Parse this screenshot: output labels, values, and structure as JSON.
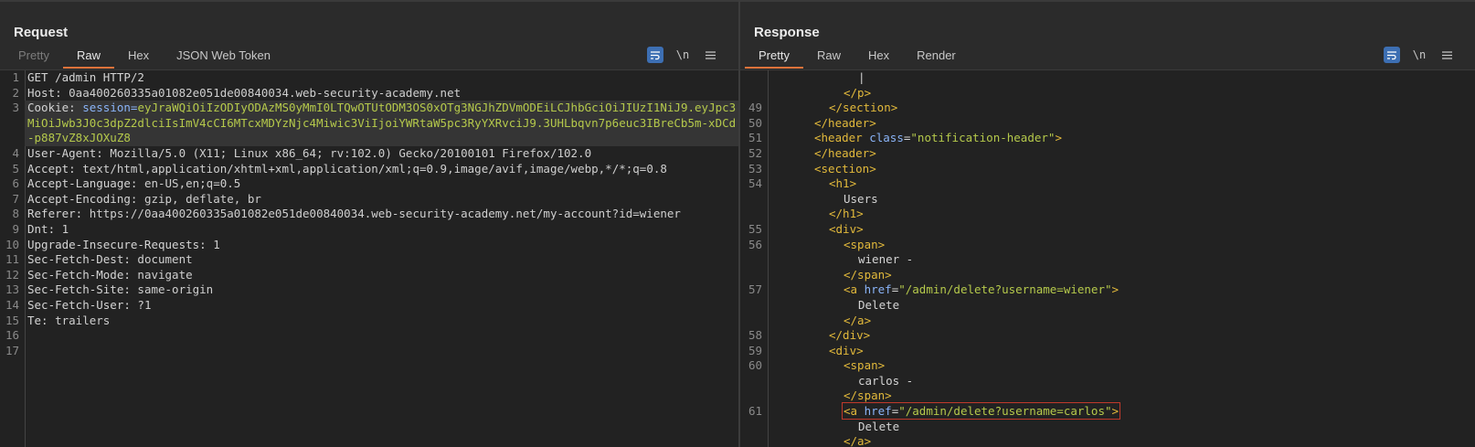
{
  "request": {
    "title": "Request",
    "tabs": [
      {
        "label": "Pretty",
        "state": "disabled"
      },
      {
        "label": "Raw",
        "state": "active"
      },
      {
        "label": "Hex",
        "state": "normal"
      },
      {
        "label": "JSON Web Token",
        "state": "normal"
      }
    ],
    "tools": {
      "wrap_icon": "wrap-lines-icon",
      "newline_label": "\\n",
      "menu_icon": "menu-icon"
    },
    "lines": [
      {
        "n": "1",
        "name": "GET /admin HTTP/2",
        "value": ""
      },
      {
        "n": "2",
        "name": "Host: ",
        "value": "0aa400260335a01082e051de00840034.web-security-academy.net"
      },
      {
        "n": "3",
        "name": "Cookie: ",
        "cookie_name": "session=",
        "cookie_value": "eyJraWQiOiIzODIyODAzMS0yMmI0LTQwOTUtODM3OS0xOTg3NGJhZDVmODEiLCJhbGciOiJIUzI1NiJ9.eyJpc3MiOiJwb3J0c3dpZ2dlciIsImV4cCI6MTcxMDYzNjc4Miwic3ViIjoiYWRtaW5pc3RyYXRvciJ9.3UHLbqvn7p6euc3IBreCb5m-xDCd-p887vZ8xJOXuZ8"
      },
      {
        "n": "4",
        "name": "User-Agent: ",
        "value": "Mozilla/5.0 (X11; Linux x86_64; rv:102.0) Gecko/20100101 Firefox/102.0"
      },
      {
        "n": "5",
        "name": "Accept: ",
        "value": "text/html,application/xhtml+xml,application/xml;q=0.9,image/avif,image/webp,*/*;q=0.8"
      },
      {
        "n": "6",
        "name": "Accept-Language: ",
        "value": "en-US,en;q=0.5"
      },
      {
        "n": "7",
        "name": "Accept-Encoding: ",
        "value": "gzip, deflate, br"
      },
      {
        "n": "8",
        "name": "Referer: ",
        "value": "https://0aa400260335a01082e051de00840034.web-security-academy.net/my-account?id=wiener"
      },
      {
        "n": "9",
        "name": "Dnt: ",
        "value": "1"
      },
      {
        "n": "10",
        "name": "Upgrade-Insecure-Requests: ",
        "value": "1"
      },
      {
        "n": "11",
        "name": "Sec-Fetch-Dest: ",
        "value": "document"
      },
      {
        "n": "12",
        "name": "Sec-Fetch-Mode: ",
        "value": "navigate"
      },
      {
        "n": "13",
        "name": "Sec-Fetch-Site: ",
        "value": "same-origin"
      },
      {
        "n": "14",
        "name": "Sec-Fetch-User: ",
        "value": "?1"
      },
      {
        "n": "15",
        "name": "Te: ",
        "value": "trailers"
      },
      {
        "n": "16",
        "name": "",
        "value": ""
      },
      {
        "n": "17",
        "name": "",
        "value": ""
      }
    ]
  },
  "response": {
    "title": "Response",
    "tabs": [
      {
        "label": "Pretty",
        "state": "active"
      },
      {
        "label": "Raw",
        "state": "normal"
      },
      {
        "label": "Hex",
        "state": "normal"
      },
      {
        "label": "Render",
        "state": "normal"
      }
    ],
    "tools": {
      "wrap_icon": "wrap-lines-icon",
      "newline_label": "\\n",
      "menu_icon": "menu-icon"
    },
    "lines": [
      {
        "n": "",
        "indent": 6,
        "parts": [
          {
            "c": "txt",
            "t": "|"
          }
        ]
      },
      {
        "n": "",
        "indent": 5,
        "parts": [
          {
            "c": "tag",
            "t": "</p>"
          }
        ]
      },
      {
        "n": "49",
        "indent": 4,
        "parts": [
          {
            "c": "tag",
            "t": "</section>"
          }
        ]
      },
      {
        "n": "50",
        "indent": 3,
        "parts": [
          {
            "c": "tag",
            "t": "</header>"
          }
        ]
      },
      {
        "n": "51",
        "indent": 3,
        "parts": [
          {
            "c": "tag",
            "t": "<header "
          },
          {
            "c": "attr",
            "t": "class"
          },
          {
            "c": "txt",
            "t": "="
          },
          {
            "c": "aval",
            "t": "\"notification-header\""
          },
          {
            "c": "tag",
            "t": ">"
          }
        ]
      },
      {
        "n": "52",
        "indent": 3,
        "parts": [
          {
            "c": "tag",
            "t": "</header>"
          }
        ]
      },
      {
        "n": "53",
        "indent": 3,
        "parts": [
          {
            "c": "tag",
            "t": "<section>"
          }
        ]
      },
      {
        "n": "54",
        "indent": 4,
        "parts": [
          {
            "c": "tag",
            "t": "<h1>"
          }
        ]
      },
      {
        "n": "",
        "indent": 5,
        "parts": [
          {
            "c": "txt",
            "t": "Users"
          }
        ]
      },
      {
        "n": "",
        "indent": 4,
        "parts": [
          {
            "c": "tag",
            "t": "</h1>"
          }
        ]
      },
      {
        "n": "55",
        "indent": 4,
        "parts": [
          {
            "c": "tag",
            "t": "<div>"
          }
        ]
      },
      {
        "n": "56",
        "indent": 5,
        "parts": [
          {
            "c": "tag",
            "t": "<span>"
          }
        ]
      },
      {
        "n": "",
        "indent": 6,
        "parts": [
          {
            "c": "txt",
            "t": "wiener -"
          }
        ]
      },
      {
        "n": "",
        "indent": 5,
        "parts": [
          {
            "c": "tag",
            "t": "</span>"
          }
        ]
      },
      {
        "n": "57",
        "indent": 5,
        "parts": [
          {
            "c": "tag",
            "t": "<a "
          },
          {
            "c": "attr",
            "t": "href"
          },
          {
            "c": "txt",
            "t": "="
          },
          {
            "c": "aval",
            "t": "\"/admin/delete?username=wiener\""
          },
          {
            "c": "tag",
            "t": ">"
          }
        ]
      },
      {
        "n": "",
        "indent": 6,
        "parts": [
          {
            "c": "txt",
            "t": "Delete"
          }
        ]
      },
      {
        "n": "",
        "indent": 5,
        "parts": [
          {
            "c": "tag",
            "t": "</a>"
          }
        ]
      },
      {
        "n": "58",
        "indent": 4,
        "parts": [
          {
            "c": "tag",
            "t": "</div>"
          }
        ]
      },
      {
        "n": "59",
        "indent": 4,
        "parts": [
          {
            "c": "tag",
            "t": "<div>"
          }
        ]
      },
      {
        "n": "60",
        "indent": 5,
        "parts": [
          {
            "c": "tag",
            "t": "<span>"
          }
        ]
      },
      {
        "n": "",
        "indent": 6,
        "parts": [
          {
            "c": "txt",
            "t": "carlos -"
          }
        ]
      },
      {
        "n": "",
        "indent": 5,
        "parts": [
          {
            "c": "tag",
            "t": "</span>"
          }
        ]
      },
      {
        "n": "61",
        "indent": 5,
        "boxed": true,
        "parts": [
          {
            "c": "tag",
            "t": "<a "
          },
          {
            "c": "attr",
            "t": "href"
          },
          {
            "c": "txt",
            "t": "="
          },
          {
            "c": "aval",
            "t": "\"/admin/delete?username=carlos\""
          },
          {
            "c": "tag",
            "t": ">"
          }
        ]
      },
      {
        "n": "",
        "indent": 6,
        "parts": [
          {
            "c": "txt",
            "t": "Delete"
          }
        ]
      },
      {
        "n": "",
        "indent": 5,
        "parts": [
          {
            "c": "tag",
            "t": "</a>"
          }
        ]
      }
    ]
  },
  "layout_buttons": [
    {
      "icon": "side-by-side-layout-icon",
      "active": true
    },
    {
      "icon": "stacked-layout-icon",
      "active": false
    },
    {
      "icon": "tabbed-layout-icon",
      "active": false
    }
  ]
}
